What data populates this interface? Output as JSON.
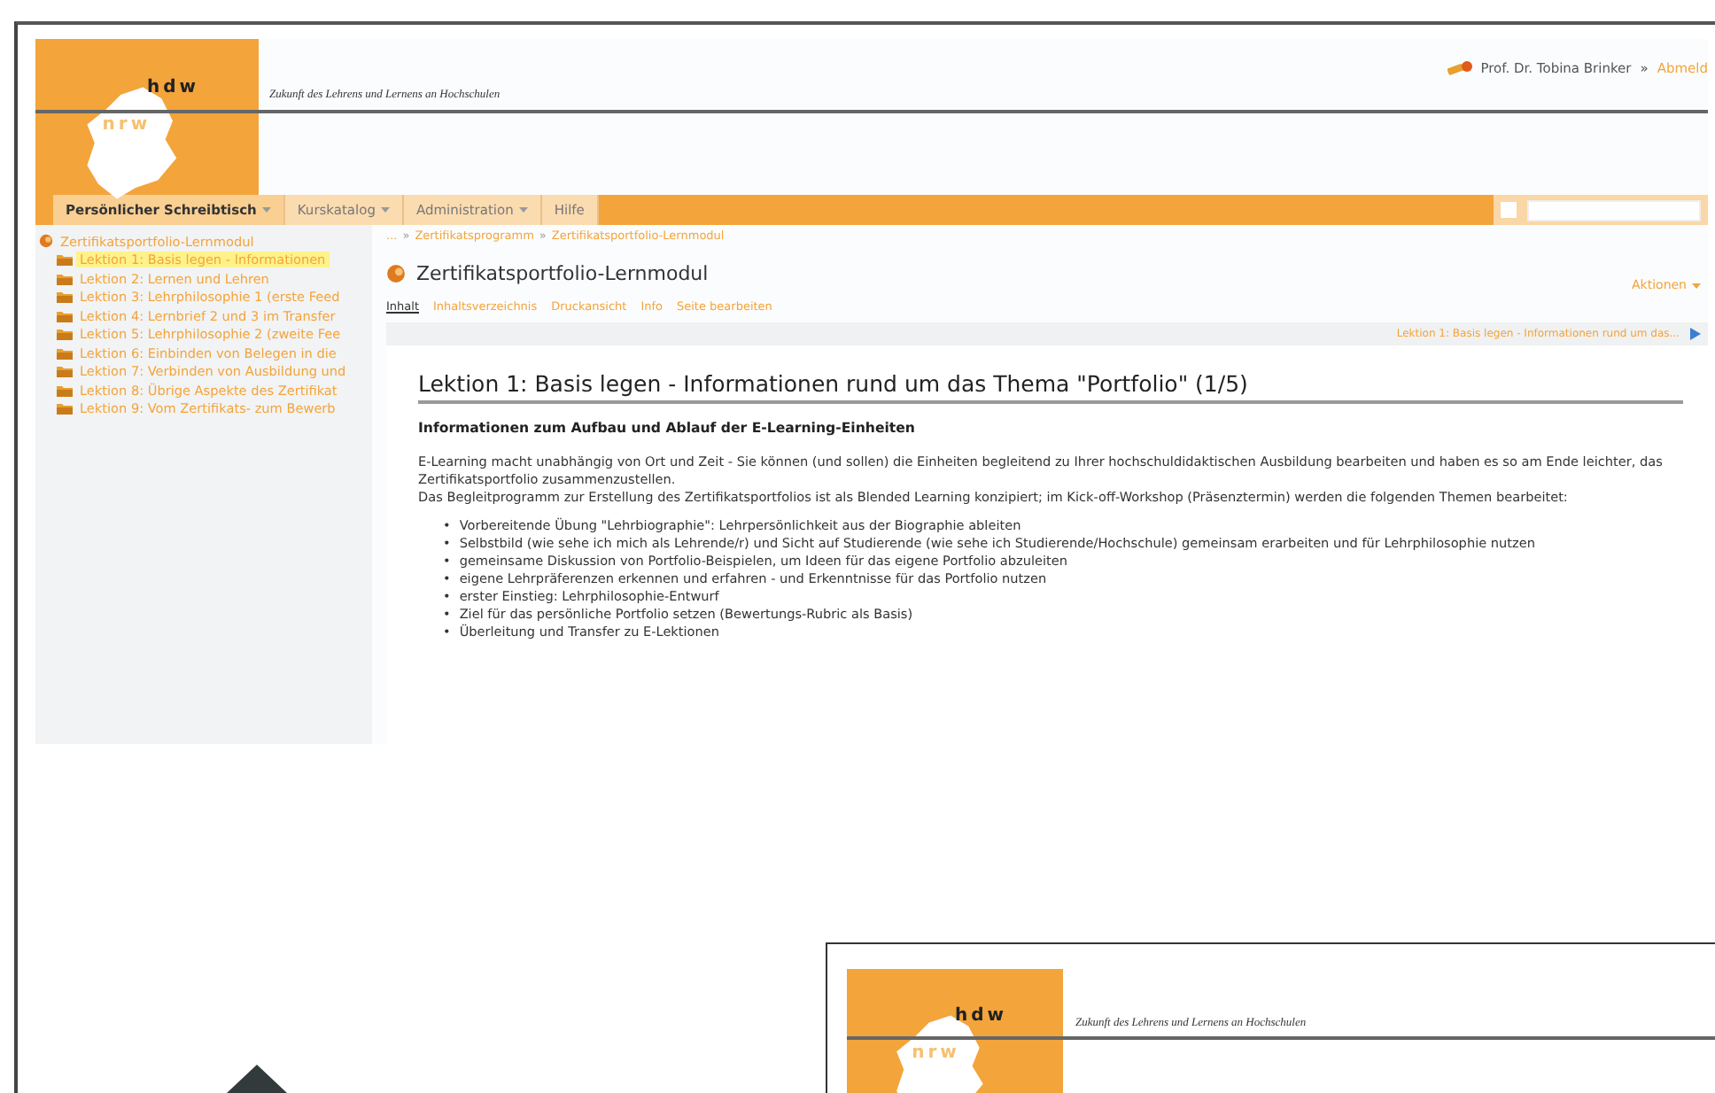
{
  "header": {
    "logo": {
      "top": "hdw",
      "bottom": "nrw"
    },
    "tagline": "Zukunft des Lehrens und Lernens an Hochschulen",
    "user": "Prof. Dr. Tobina Brinker",
    "separator": "»",
    "logout": "Abmeld"
  },
  "nav": [
    {
      "label": "Persönlicher Schreibtisch",
      "selected": true,
      "dropdown": true
    },
    {
      "label": "Kurskatalog",
      "selected": false,
      "dropdown": true
    },
    {
      "label": "Administration",
      "selected": false,
      "dropdown": true
    },
    {
      "label": "Hilfe",
      "selected": false,
      "dropdown": false
    }
  ],
  "nav_checkbox": {
    "checked": false
  },
  "sidebar": {
    "root": "Zertifikatsportfolio-Lernmodul",
    "children": [
      {
        "label": "Lektion 1: Basis legen - Informationen",
        "selected": true
      },
      {
        "label": "Lektion 2: Lernen und Lehren",
        "selected": false
      },
      {
        "label": "Lektion 3: Lehrphilosophie 1 (erste Feed",
        "selected": false
      },
      {
        "label": "Lektion 4: Lernbrief 2 und 3 im Transfer",
        "selected": false
      },
      {
        "label": "Lektion 5: Lehrphilosophie 2 (zweite Fee",
        "selected": false
      },
      {
        "label": "Lektion 6: Einbinden von Belegen in die",
        "selected": false
      },
      {
        "label": "Lektion 7: Verbinden von Ausbildung und",
        "selected": false
      },
      {
        "label": "Lektion 8: Übrige Aspekte des Zertifikat",
        "selected": false
      },
      {
        "label": "Lektion 9: Vom Zertifikats- zum Bewerb",
        "selected": false
      }
    ]
  },
  "breadcrumb": [
    "...",
    "Zertifikatsprogramm",
    "Zertifikatsportfolio-Lernmodul"
  ],
  "breadcrumb_separator": "»",
  "page_title": "Zertifikatsportfolio-Lernmodul",
  "actions": "Aktionen",
  "tabs": [
    {
      "label": "Inhalt",
      "selected": true
    },
    {
      "label": "Inhaltsverzeichnis",
      "selected": false
    },
    {
      "label": "Druckansicht",
      "selected": false
    },
    {
      "label": "Info",
      "selected": false
    },
    {
      "label": "Seite bearbeiten",
      "selected": false
    }
  ],
  "pager": "Lektion 1: Basis legen - Informationen rund um das...",
  "article": {
    "title": "Lektion 1: Basis legen - Informationen rund um das Thema \"Portfolio\" (1/5)",
    "subtitle": "Informationen zum Aufbau und Ablauf der E-Learning-Einheiten",
    "paragraphs": [
      "E-Learning macht unabhängig von Ort und Zeit - Sie können (und sollen) die Einheiten begleitend zu Ihrer hochschuldidaktischen Ausbildung bearbeiten und haben es so am Ende leichter, das Zertifikatsportfolio zusammenzustellen.",
      "Das Begleitprogramm zur Erstellung des Zertifikatsportfolios ist als Blended Learning konzipiert; im Kick-off-Workshop (Präsenztermin) werden die folgenden Themen bearbeitet:"
    ],
    "bullet_marker": "•",
    "bullets": [
      "Vorbereitende Übung \"Lehrbiographie\": Lehrpersönlichkeit aus der Biographie ableiten",
      "Selbstbild (wie sehe ich mich als Lehrende/r) und Sicht auf Studierende (wie sehe ich Studierende/Hochschule) gemeinsam erarbeiten und für Lehrphilosophie nutzen",
      "gemeinsame Diskussion von Portfolio-Beispielen, um Ideen für das eigene Portfolio abzuleiten",
      "eigene Lehrpräferenzen erkennen und erfahren - und Erkenntnisse für das Portfolio nutzen",
      "erster Einstieg: Lehrphilosophie-Entwurf",
      "Ziel für das persönliche Portfolio setzen (Bewertungs-Rubric als Basis)",
      "Überleitung und Transfer zu E-Lektionen"
    ]
  },
  "second_screenshot": {
    "logo": {
      "top": "hdw",
      "bottom": "nrw"
    },
    "tagline": "Zukunft des Lehrens und Lernens an Hochschulen"
  }
}
